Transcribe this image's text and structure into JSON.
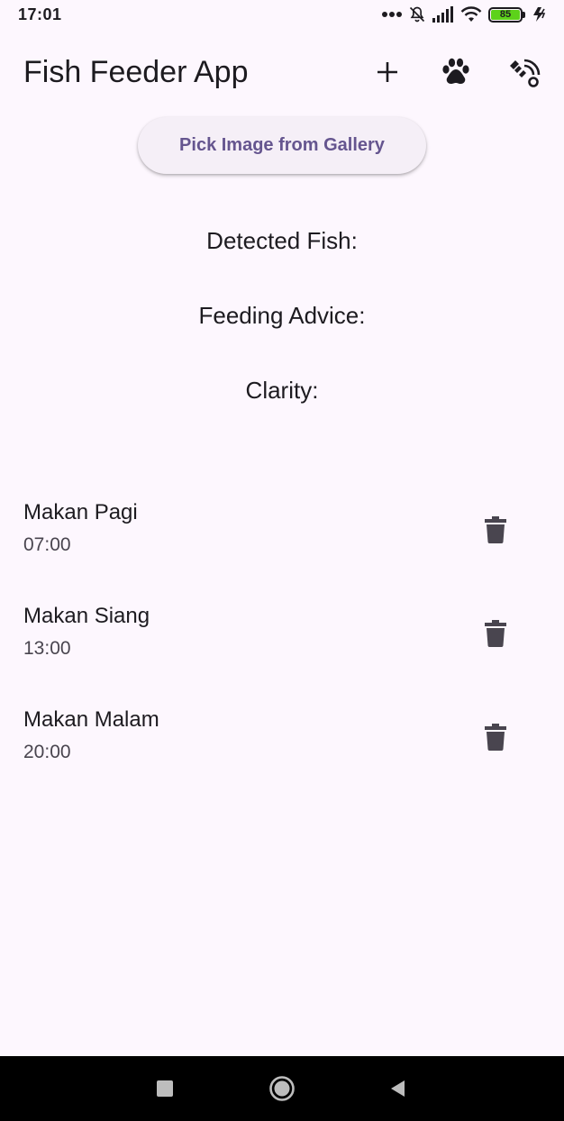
{
  "status_bar": {
    "time": "17:01",
    "battery_level": "85",
    "icons": [
      "more-dots-icon",
      "notifications-off-icon",
      "signal-icon",
      "wifi-icon",
      "battery-icon",
      "charging-icon"
    ]
  },
  "app_bar": {
    "title": "Fish Feeder App",
    "actions": [
      "add-icon",
      "paw-icon",
      "feeder-icon"
    ]
  },
  "pick_button": {
    "label": "Pick Image from Gallery"
  },
  "results": {
    "detected_fish": "Detected Fish:",
    "feeding_advice": "Feeding Advice:",
    "clarity": "Clarity:"
  },
  "schedules": [
    {
      "name": "Makan Pagi",
      "time": "07:00"
    },
    {
      "name": "Makan Siang",
      "time": "13:00"
    },
    {
      "name": "Makan Malam",
      "time": "20:00"
    }
  ],
  "colors": {
    "background": "#fdf7fe",
    "accent": "#65558f",
    "button_surface": "#f5eff7",
    "battery": "#5dd21a"
  },
  "nav_bar": {
    "icons": [
      "recents-icon",
      "home-icon",
      "back-icon"
    ]
  }
}
